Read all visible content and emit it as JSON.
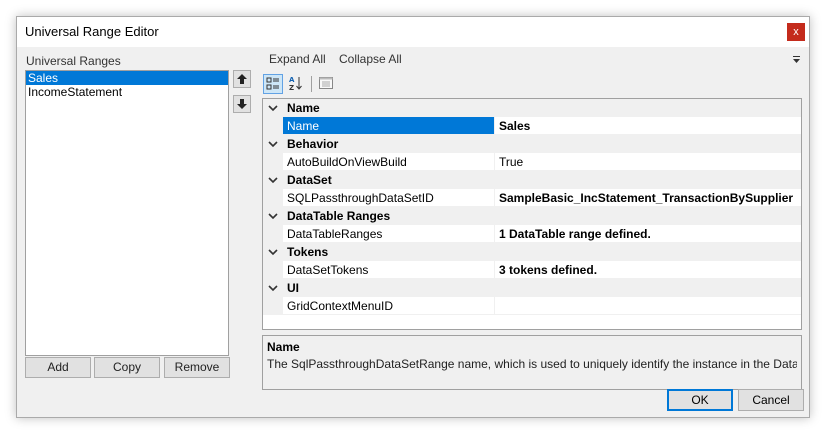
{
  "window": {
    "title": "Universal Range Editor",
    "close_glyph": "x"
  },
  "left": {
    "label": "Universal Ranges",
    "items": [
      "Sales",
      "IncomeStatement"
    ],
    "selected_index": 0,
    "buttons": {
      "add": "Add",
      "copy": "Copy",
      "remove": "Remove"
    }
  },
  "grid": {
    "expand_all": "Expand All",
    "collapse_all": "Collapse All",
    "rows": [
      {
        "type": "category",
        "label": "Name"
      },
      {
        "type": "property",
        "name": "Name",
        "value": "Sales",
        "selected": true
      },
      {
        "type": "category",
        "label": "Behavior"
      },
      {
        "type": "property",
        "name": "AutoBuildOnViewBuild",
        "value": "True"
      },
      {
        "type": "category",
        "label": "DataSet"
      },
      {
        "type": "property",
        "name": "SQLPassthroughDataSetID",
        "value": "SampleBasic_IncStatement_TransactionBySupplier"
      },
      {
        "type": "category",
        "label": "DataTable Ranges"
      },
      {
        "type": "property",
        "name": "DataTableRanges",
        "value": "1 DataTable range defined."
      },
      {
        "type": "category",
        "label": "Tokens"
      },
      {
        "type": "property",
        "name": "DataSetTokens",
        "value": "3 tokens defined."
      },
      {
        "type": "category",
        "label": "UI"
      },
      {
        "type": "property",
        "name": "GridContextMenuID",
        "value": ""
      }
    ],
    "description": {
      "title": "Name",
      "text": "The SqlPassthroughDataSetRange name, which is used to uniquely identify the instance in the DataSet R..."
    }
  },
  "footer": {
    "ok": "OK",
    "cancel": "Cancel"
  },
  "colors": {
    "selection": "#0078d7",
    "close": "#c42b1c",
    "dialog_bg": "#f0f0f0"
  },
  "icons": [
    "close-icon",
    "arrow-up-icon",
    "arrow-down-icon",
    "categorized-icon",
    "alphabetical-sort-icon",
    "property-pages-icon",
    "chevron-down-icon",
    "toolbar-menu-icon"
  ]
}
